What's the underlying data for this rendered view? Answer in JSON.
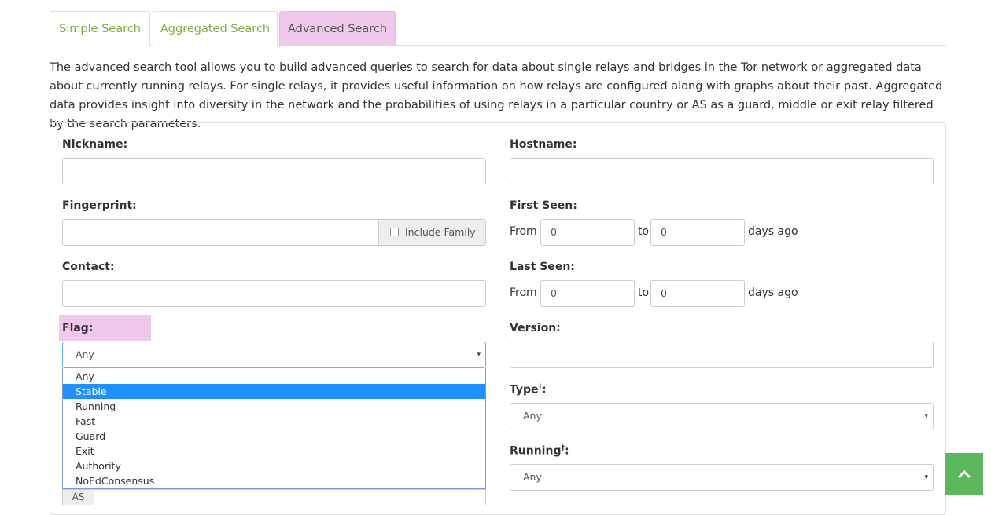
{
  "tabs": [
    {
      "label": "Simple Search",
      "active": false
    },
    {
      "label": "Aggregated Search",
      "active": false
    },
    {
      "label": "Advanced Search",
      "active": true
    }
  ],
  "intro_text": "The advanced search tool allows you to build advanced queries to search for data about single relays and bridges in the Tor network or aggregated data about currently running relays. For single relays, it provides useful information on how relays are configured along with graphs about their past. Aggregated data provides insight into diversity in the network and the probabilities of using relays in a particular country or AS as a guard, middle or exit relay filtered by the search parameters.",
  "form": {
    "nickname": {
      "label": "Nickname:",
      "value": ""
    },
    "fingerprint": {
      "label": "Fingerprint:",
      "value": "",
      "include_family_label": "Include Family",
      "include_family_checked": false
    },
    "contact": {
      "label": "Contact:",
      "value": ""
    },
    "flag": {
      "label": "Flag:",
      "selected": "Any",
      "options": [
        "Any",
        "Stable",
        "Running",
        "Fast",
        "Guard",
        "Exit",
        "Authority",
        "NoEdConsensus"
      ],
      "highlighted_option": "Stable"
    },
    "as_label": "AS",
    "hostname": {
      "label": "Hostname:",
      "value": ""
    },
    "first_seen": {
      "label": "First Seen:",
      "from_label": "From",
      "from_value": "0",
      "to_label": "to",
      "to_value": "0",
      "suffix": "days ago"
    },
    "last_seen": {
      "label": "Last Seen:",
      "from_label": "From",
      "from_value": "0",
      "to_label": "to",
      "to_value": "0",
      "suffix": "days ago"
    },
    "version": {
      "label": "Version:",
      "value": ""
    },
    "type": {
      "label": "Type",
      "marker": "†",
      "colon": ":",
      "selected": "Any"
    },
    "running": {
      "label": "Running",
      "marker": "†",
      "colon": ":",
      "selected": "Any"
    }
  },
  "colors": {
    "tab_link": "#7ab03f",
    "highlight": "#f0c8ec",
    "selected_option": "#1e90ff",
    "scroll_top_button": "#5cb85c"
  },
  "icons": {
    "select_caret": "▾",
    "scroll_top": "chevron-up-icon"
  }
}
